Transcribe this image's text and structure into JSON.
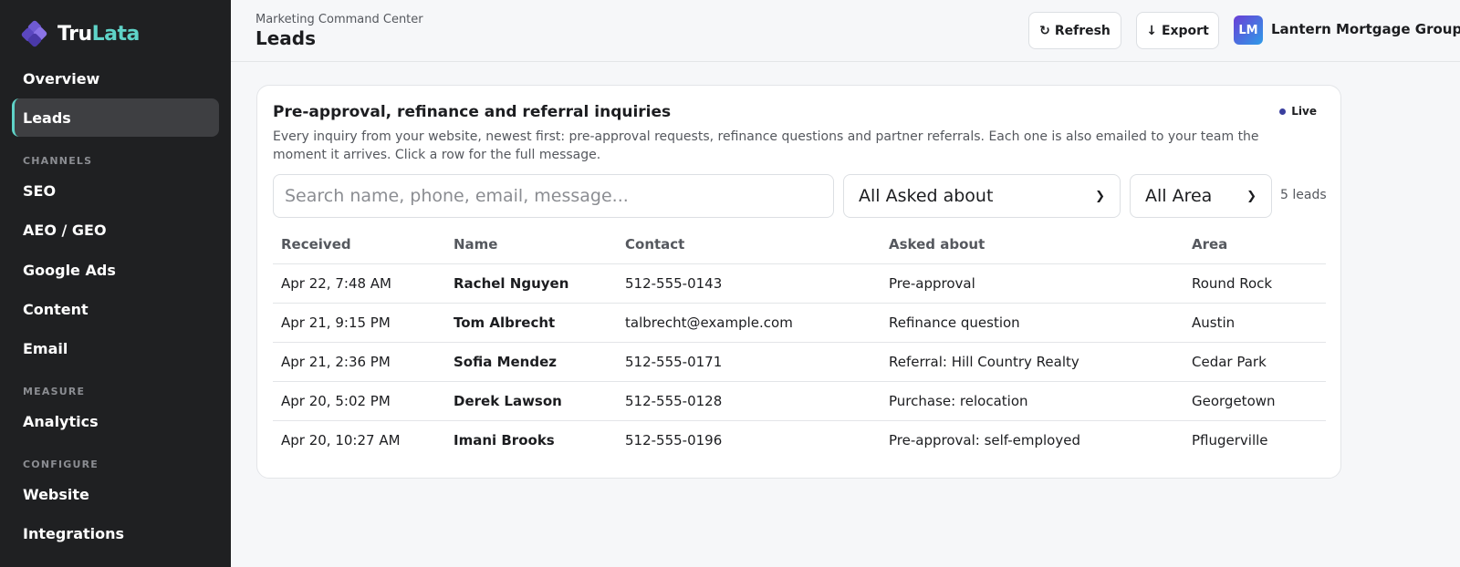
{
  "brand": {
    "name_part1": "Tru",
    "name_part2": "Lata",
    "accent": "#5fd3c8"
  },
  "sidebar": {
    "items": [
      {
        "label": "Overview"
      },
      {
        "label": "Leads",
        "active": true
      },
      {
        "label": "SEO"
      },
      {
        "label": "AEO / GEO"
      },
      {
        "label": "Google Ads"
      },
      {
        "label": "Content"
      },
      {
        "label": "Email"
      },
      {
        "label": "Analytics"
      },
      {
        "label": "Website"
      },
      {
        "label": "Integrations"
      }
    ],
    "sections": [
      "CHANNELS",
      "MEASURE",
      "CONFIGURE"
    ]
  },
  "header": {
    "eyebrow": "Marketing Command Center",
    "title": "Leads",
    "refresh_label": "Refresh",
    "export_label": "Export",
    "avatar_initials": "LM",
    "org_name": "Lantern Mortgage Group"
  },
  "card": {
    "title": "Pre-approval, refinance and referral inquiries",
    "live_label": "Live",
    "description": "Every inquiry from your website, newest first: pre-approval requests, refinance questions and partner referrals. Each one is also emailed to your team the moment it arrives. Click a row for the full message.",
    "search_placeholder": "Search name, phone, email, message...",
    "asked_filter": "All Asked about",
    "area_filter": "All Area",
    "lead_count": "5 leads"
  },
  "table": {
    "headers": [
      "Received",
      "Name",
      "Contact",
      "Asked about",
      "Area"
    ],
    "rows": [
      [
        "Apr 22, 7:48 AM",
        "Rachel Nguyen",
        "512-555-0143",
        "Pre-approval",
        "Round Rock"
      ],
      [
        "Apr 21, 9:15 PM",
        "Tom Albrecht",
        "talbrecht@example.com",
        "Refinance question",
        "Austin"
      ],
      [
        "Apr 21, 2:36 PM",
        "Sofia Mendez",
        "512-555-0171",
        "Referral: Hill Country Realty",
        "Cedar Park"
      ],
      [
        "Apr 20, 5:02 PM",
        "Derek Lawson",
        "512-555-0128",
        "Purchase: relocation",
        "Georgetown"
      ],
      [
        "Apr 20, 10:27 AM",
        "Imani Brooks",
        "512-555-0196",
        "Pre-approval: self-employed",
        "Pflugerville"
      ]
    ]
  }
}
